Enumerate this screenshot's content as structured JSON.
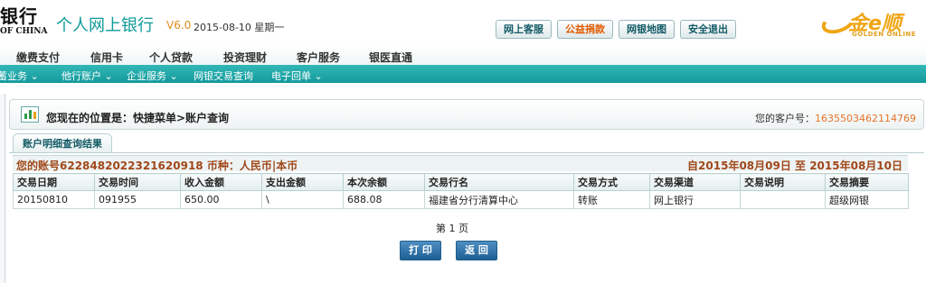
{
  "header": {
    "logo_cn": "银行",
    "logo_en": "OF CHINA",
    "title": "个人网上银行",
    "version": "V6.0",
    "datetime": "2015-08-10 星期一",
    "buttons": [
      "网上客服",
      "公益捐款",
      "网银地图",
      "安全退出"
    ],
    "brand_name": "金e顺",
    "brand_en": "GOLDEN ONLINE"
  },
  "main_nav": [
    "缴费支付",
    "信用卡",
    "个人贷款",
    "投资理财",
    "客户服务",
    "银医直通"
  ],
  "sub_nav": [
    "储蓄业务 ⌄",
    "他行账户 ⌄",
    "企业服务 ⌄",
    "网银交易查询",
    "电子回单 ⌄"
  ],
  "location": {
    "text": "您现在的位置是：快捷菜单>账户查询",
    "customer_label": "您的客户号：",
    "customer_no": "1635503462114769"
  },
  "tab": "账户明细查询结果",
  "account": {
    "summary": "您的账号6228482022321620918 币种：人民币|本币",
    "range": "自2015年08月09日 至 2015年08月10日"
  },
  "table": {
    "headers": [
      "交易日期",
      "交易时间",
      "收入金额",
      "支出金额",
      "本次余额",
      "交易行名",
      "交易方式",
      "交易渠道",
      "交易说明",
      "交易摘要"
    ],
    "rows": [
      [
        "20150810",
        "091955",
        "650.00",
        "\\",
        "688.08",
        "福建省分行清算中心",
        "转账",
        "网上银行",
        "",
        "超级网银"
      ]
    ]
  },
  "pagination": "第 1 页",
  "actions": {
    "print": "打 印",
    "back": "返 回"
  },
  "colors": {
    "teal": "#159a9c",
    "title": "#0e9a9a",
    "accent_orange": "#e6742a",
    "account_brown": "#a0481a"
  }
}
